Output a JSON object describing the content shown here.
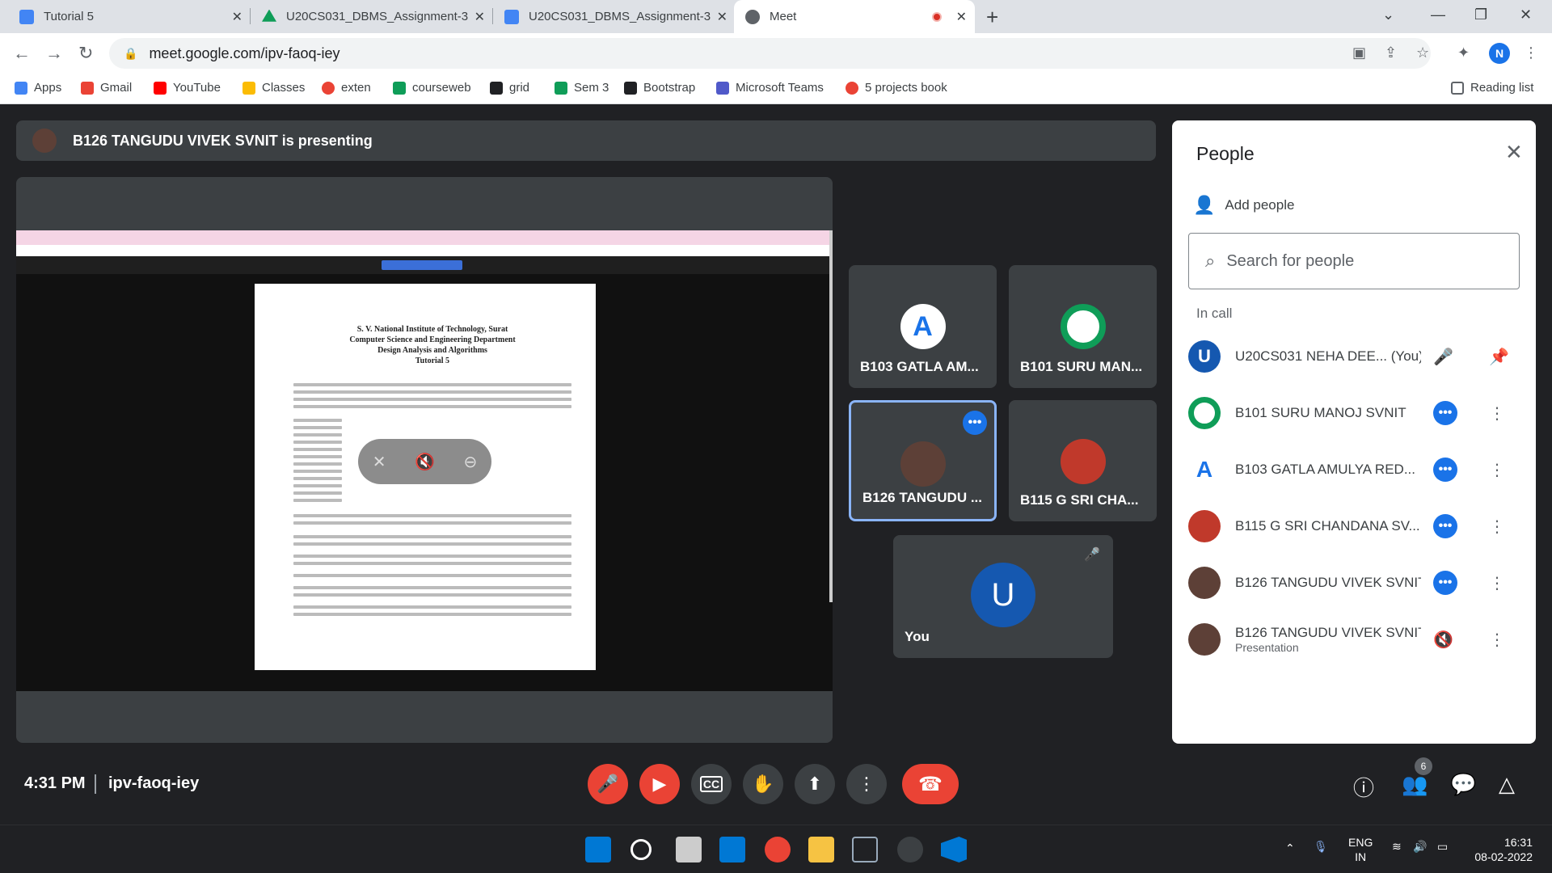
{
  "browser": {
    "tabs": [
      {
        "title": "Tutorial 5",
        "color": "#4285f4"
      },
      {
        "title": "U20CS031_DBMS_Assignment-3.",
        "color": "#0f9d58"
      },
      {
        "title": "U20CS031_DBMS_Assignment-3",
        "color": "#4285f4"
      },
      {
        "title": "Meet",
        "color": "#5f6368"
      }
    ],
    "url": "meet.google.com/ipv-faoq-iey",
    "profile_initial": "N",
    "bookmarks": [
      {
        "label": "Apps",
        "color": "#4285f4"
      },
      {
        "label": "Gmail",
        "color": "#ea4335"
      },
      {
        "label": "YouTube",
        "color": "#ff0000"
      },
      {
        "label": "Classes",
        "color": "#fbbc04"
      },
      {
        "label": "exten",
        "color": "#ea4335"
      },
      {
        "label": "courseweb",
        "color": "#0f9d58"
      },
      {
        "label": "grid",
        "color": "#202124"
      },
      {
        "label": "Sem 3",
        "color": "#0f9d58"
      },
      {
        "label": "Bootstrap",
        "color": "#202124"
      },
      {
        "label": "Microsoft Teams",
        "color": "#5059c9"
      },
      {
        "label": "5 projects book",
        "color": "#ea4335"
      }
    ],
    "reading_list": "Reading list"
  },
  "meet": {
    "presenting_banner": "B126 TANGUDU VIVEK SVNIT is presenting",
    "shared_doc": {
      "heading": [
        "S. V. National Institute of Technology, Surat",
        "Computer Science and Engineering Department",
        "Design Analysis and Algorithms",
        "Tutorial 5"
      ]
    },
    "tiles": [
      {
        "name": "B103 GATLA AM...",
        "initial": "A"
      },
      {
        "name": "B101 SURU MAN...",
        "initial": ""
      },
      {
        "name": "B126 TANGUDU ...",
        "initial": ""
      },
      {
        "name": "B115 G SRI CHA...",
        "initial": ""
      },
      {
        "name": "You",
        "initial": "U"
      }
    ],
    "time": "4:31 PM",
    "meeting_code": "ipv-faoq-iey",
    "participant_count": "6"
  },
  "people": {
    "title": "People",
    "add_people": "Add people",
    "search_placeholder": "Search for people",
    "section": "In call",
    "list": [
      {
        "name": "U20CS031 NEHA DEE... (You)",
        "sub": "",
        "initial": "U",
        "color": "#1a73e8"
      },
      {
        "name": "B101 SURU MANOJ SVNIT",
        "sub": "",
        "initial": "",
        "color": "#0f9d58"
      },
      {
        "name": "B103 GATLA AMULYA RED...",
        "sub": "",
        "initial": "A",
        "color": "#ffffff"
      },
      {
        "name": "B115 G SRI CHANDANA SV...",
        "sub": "",
        "initial": "",
        "color": "#c0392b"
      },
      {
        "name": "B126 TANGUDU VIVEK SVNIT",
        "sub": "",
        "initial": "",
        "color": "#5d4037"
      },
      {
        "name": "B126 TANGUDU VIVEK SVNIT",
        "sub": "Presentation",
        "initial": "",
        "color": "#5d4037"
      }
    ]
  },
  "taskbar": {
    "lang1": "ENG",
    "lang2": "IN",
    "clock_time": "16:31",
    "clock_date": "08-02-2022"
  }
}
